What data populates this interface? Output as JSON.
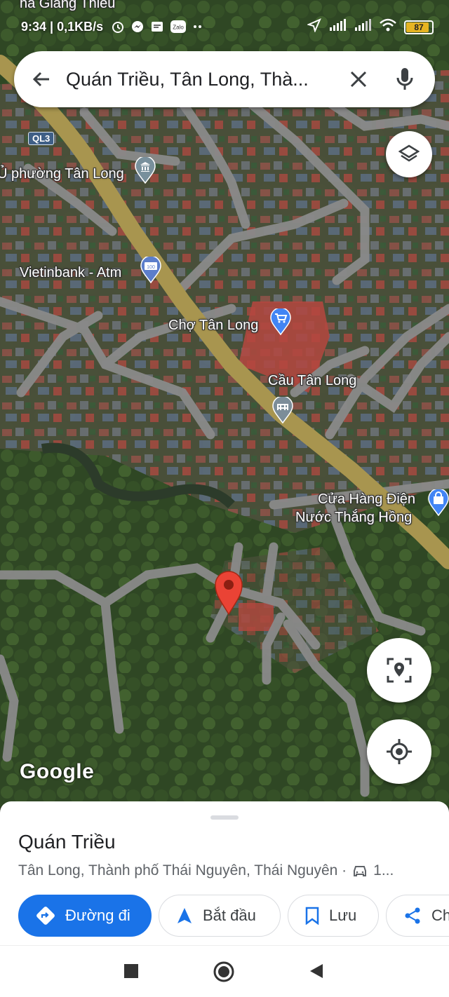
{
  "status_bar": {
    "time": "9:34",
    "speed": "0,1KB/s",
    "battery": "87",
    "notification_app": "Zalo"
  },
  "search": {
    "query": "Quán Triều, Tân Long, Thà..."
  },
  "map": {
    "top_label": "ha Giang Thiều",
    "road_badge": "QL3",
    "labels": {
      "ward": "Ủ phường Tân Long",
      "atm": "Vietinbank - Atm",
      "atm_badge": "100",
      "market": "Chợ Tân Long",
      "bridge": "Cầu Tân Long",
      "shop_line1": "Cửa Hàng Điện",
      "shop_line2": "Nước Thắng Hồng"
    },
    "watermark": "Google"
  },
  "place": {
    "title": "Quán Triều",
    "subtitle": "Tân Long, Thành phố Thái Nguyên, Thái Nguyên ·",
    "drive_time": "1..."
  },
  "actions": {
    "directions": "Đường đi",
    "start": "Bắt đầu",
    "save": "Lưu",
    "share": "Ch"
  },
  "colors": {
    "accent": "#1a73e8",
    "pin": "#ea4335",
    "road": "#a8954f"
  }
}
